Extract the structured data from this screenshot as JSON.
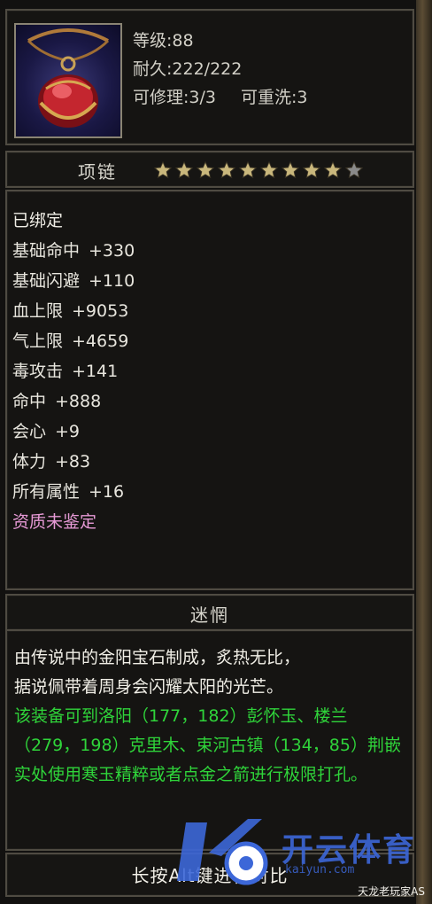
{
  "header": {
    "level": "等级:88",
    "durability": "耐久:222/222",
    "repairable": "可修理:3/3",
    "rewashable": "可重洗:3"
  },
  "item": {
    "name": "项链",
    "stars_filled": 9,
    "stars_total": 10,
    "icon": "ruby-necklace-icon"
  },
  "attributes": {
    "bound": "已绑定",
    "rows": [
      {
        "label": "基础命中",
        "value": "+330"
      },
      {
        "label": "基础闪避",
        "value": "+110"
      },
      {
        "label": "血上限",
        "value": "+9053"
      },
      {
        "label": "气上限",
        "value": "+4659"
      },
      {
        "label": "毒攻击",
        "value": "+141"
      },
      {
        "label": "命中",
        "value": "+888"
      },
      {
        "label": "会心",
        "value": "+9"
      },
      {
        "label": "体力",
        "value": "+83"
      },
      {
        "label": "所有属性",
        "value": "+16"
      }
    ],
    "quality": "资质未鉴定"
  },
  "description": {
    "title": "迷惘",
    "flavor": "由传说中的金阳宝石制成，炙热无比，\n据说佩带着周身会闪耀太阳的光芒。",
    "hint": "该装备可到洛阳（177，182）彭怀玉、楼兰（279，198）克里木、束河古镇（134，85）荆嵌实处使用寒玉精粹或者点金之箭进行极限打孔。"
  },
  "bottom": {
    "hint_label": "长按Alt键进行对比"
  },
  "watermark": {
    "brand": "开云体育",
    "domain": "kaiyun.com"
  },
  "signature": "天龙老玩家AS",
  "colors": {
    "star_filled": "#c9b77c",
    "star_empty": "#8a8a8a",
    "hint_green": "#2fd43a",
    "quality_pink": "#e79ad6"
  }
}
